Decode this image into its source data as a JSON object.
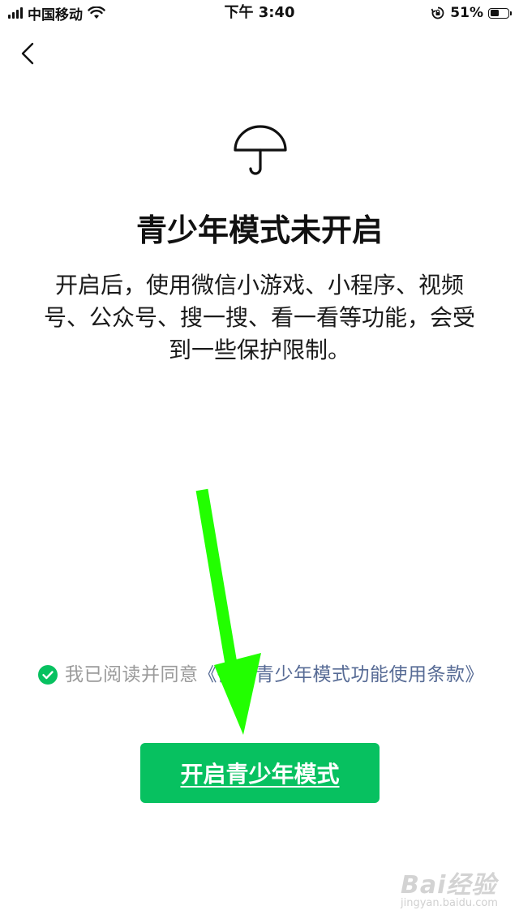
{
  "status_bar": {
    "carrier": "中国移动",
    "time": "下午 3:40",
    "battery_percent_label": "51%",
    "battery_level": 0.51
  },
  "nav": {
    "back_icon": "chevron-left-icon"
  },
  "hero": {
    "icon": "umbrella-icon",
    "title": "青少年模式未开启",
    "description": "开启后，使用微信小游戏、小程序、视频号、公众号、搜一搜、看一看等功能，会受到一些保护限制。"
  },
  "agreement": {
    "checked": true,
    "prefix": "我已阅读并同意",
    "link": "《微信青少年模式功能使用条款》"
  },
  "primary_button": {
    "label": "开启青少年模式"
  },
  "annotation": {
    "arrow_color": "#22ff00"
  },
  "watermark": {
    "brand": "Bai经验",
    "url": "jingyan.baidu.com"
  },
  "colors": {
    "accent_green": "#07c160",
    "link_blue": "#576b95",
    "muted_text": "#9b9b9b"
  }
}
